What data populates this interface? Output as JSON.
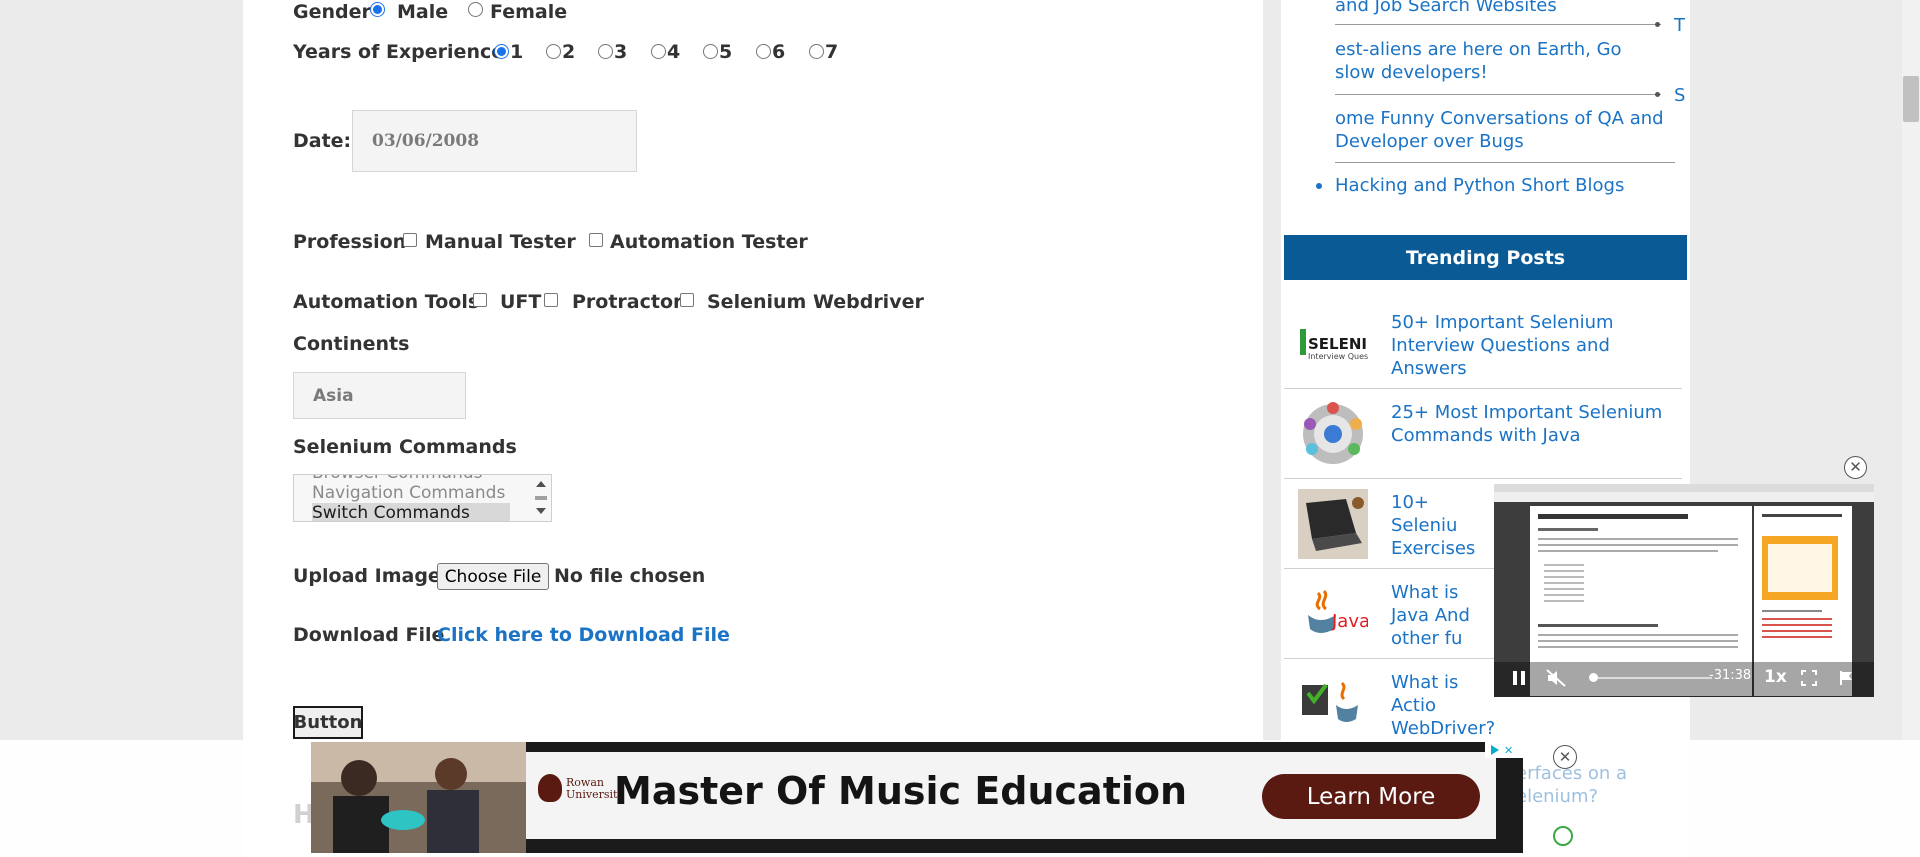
{
  "form": {
    "gender_label": "Gender",
    "gender_male": "Male",
    "gender_female": "Female",
    "experience_label": "Years of Experience",
    "experience_options": [
      "1",
      "2",
      "3",
      "4",
      "5",
      "6",
      "7"
    ],
    "experience_selected": "1",
    "date_label": "Date:",
    "date_value": "03/06/2008",
    "profession_label": "Profession",
    "profession_manual": "Manual Tester",
    "profession_automation": "Automation Tester",
    "tools_label": "Automation Tools",
    "tools_uft": "UFT",
    "tools_protractor": "Protractor",
    "tools_selenium": "Selenium Webdriver",
    "continents_label": "Continents",
    "continents_value": "Asia",
    "commands_label": "Selenium Commands",
    "commands_options": [
      "Browser Commands",
      "Navigation Commands",
      "Switch Commands"
    ],
    "commands_selected": "Switch Commands",
    "upload_label": "Upload Image",
    "upload_button": "Choose File",
    "upload_status": "No file chosen",
    "download_label": "Download File",
    "download_link": "Click here to Download File",
    "button_label": "Button",
    "cut_heading": "H"
  },
  "sidebar": {
    "links": [
      "and Job Search Websites",
      "est-aliens are here on Earth, Go slow developers!",
      "ome Funny Conversations of QA and Developer over Bugs",
      "Hacking and Python Short Blogs"
    ],
    "bullet_letters": [
      "T",
      "S"
    ],
    "trending_title": "Trending Posts",
    "posts": [
      "50+ Important Selenium Interview Questions and Answers",
      "25+ Most Important Selenium Commands with Java",
      "10+ Seleniu Exercises",
      "What is Java And other fu",
      "What is Actio WebDriver?"
    ],
    "post_cut": "erfaces on a elenium?",
    "thumb_captions": [
      "SELENIU",
      "Interview Ques",
      "Java"
    ]
  },
  "video": {
    "time": "-31:38",
    "speed": "1x"
  },
  "ad": {
    "brand": "Rowan University",
    "headline": "Master Of Music Education",
    "cta": "Learn More"
  },
  "colors": {
    "accent": "#1a73c5",
    "trending_bg": "#0a5a96",
    "ad_cta_bg": "#5a1a12"
  }
}
